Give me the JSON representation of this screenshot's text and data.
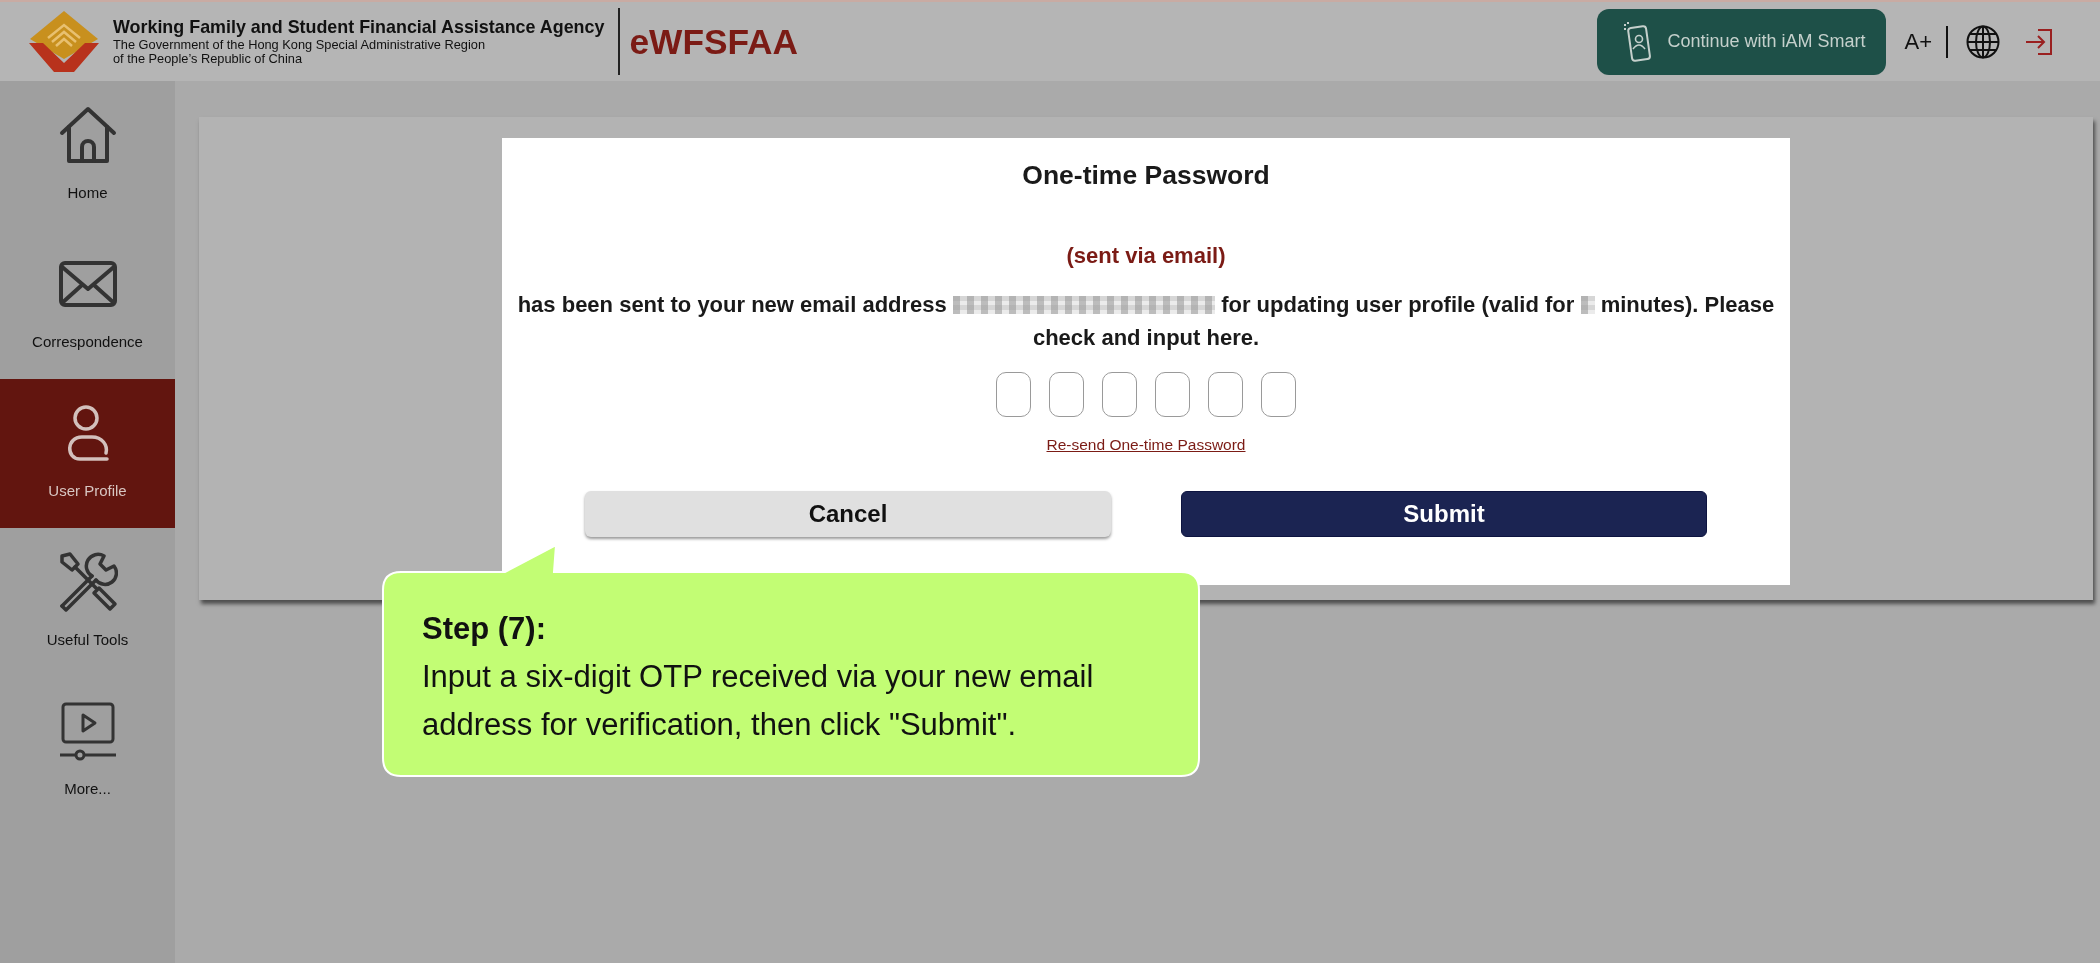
{
  "header": {
    "agency_name": "Working Family and Student Financial Assistance Agency",
    "government_lines": [
      "The Government of the Hong Kong Special Administrative Region",
      "of the People’s Republic of China"
    ],
    "system_name": "eWFSFAA",
    "iam_smart_button": "Continue with iAM Smart",
    "font_size_button": "A+"
  },
  "sidebar": {
    "items": [
      {
        "label": "Home",
        "selected": false
      },
      {
        "label": "Correspondence",
        "selected": false
      },
      {
        "label": "User Profile",
        "selected": true
      },
      {
        "label": "Useful Tools",
        "selected": false
      },
      {
        "label": "More...",
        "selected": false
      }
    ]
  },
  "dialog": {
    "title": "One-time Password",
    "subtitle": "(sent via email)",
    "message": [
      "has been sent to your new email address",
      "for updating user profile (valid for",
      "minutes). Please",
      "check and input here."
    ],
    "otp_fields": [
      {
        "kind": "digit"
      },
      {
        "kind": "digit"
      },
      {
        "kind": "digit"
      },
      {
        "kind": "digit"
      },
      {
        "kind": "digit"
      },
      {
        "kind": "digit"
      }
    ],
    "resend_link": "Re-send One-time Password",
    "buttons": [
      {
        "label": "Cancel",
        "kind": "secondary"
      },
      {
        "label": "Submit",
        "kind": "primary"
      }
    ]
  },
  "callout": {
    "title": "Step (7):",
    "text": "Input a six-digit OTP received via your new email address for verification, then click \"Submit\"."
  }
}
